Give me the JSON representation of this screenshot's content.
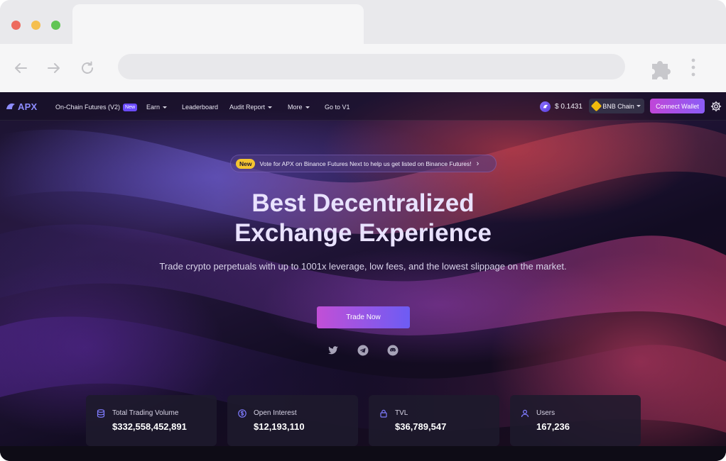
{
  "app": {
    "logo_text": "APX"
  },
  "nav": {
    "items": [
      {
        "label": "On-Chain Futures (V2)",
        "badge": "New"
      },
      {
        "label": "Earn"
      },
      {
        "label": "Leaderboard"
      },
      {
        "label": "Audit Report"
      },
      {
        "label": "More"
      },
      {
        "label": "Go to V1"
      }
    ],
    "price": "$ 0.1431",
    "chain": "BNB Chain",
    "connect_label": "Connect Wallet"
  },
  "announcement": {
    "badge": "New",
    "text": "Vote for APX on Binance Futures Next to help us get listed on Binance Futures!",
    "chevron": "›"
  },
  "hero": {
    "title_line1": "Best Decentralized",
    "title_line2": "Exchange Experience",
    "subtitle": "Trade crypto perpetuals with up to 1001x leverage, low fees, and the lowest slippage on the market.",
    "cta": "Trade Now"
  },
  "social": [
    "twitter-icon",
    "telegram-icon",
    "discord-icon"
  ],
  "stats": [
    {
      "icon": "database-icon",
      "label": "Total Trading Volume",
      "value": "$332,558,452,891"
    },
    {
      "icon": "dollar-icon",
      "label": "Open Interest",
      "value": "$12,193,110"
    },
    {
      "icon": "lock-icon",
      "label": "TVL",
      "value": "$36,789,547"
    },
    {
      "icon": "user-icon",
      "label": "Users",
      "value": "167,236"
    }
  ],
  "colors": {
    "accent": "#8b5cf6",
    "cta_start": "#c24fd6",
    "badge_yellow": "#f4c430"
  }
}
